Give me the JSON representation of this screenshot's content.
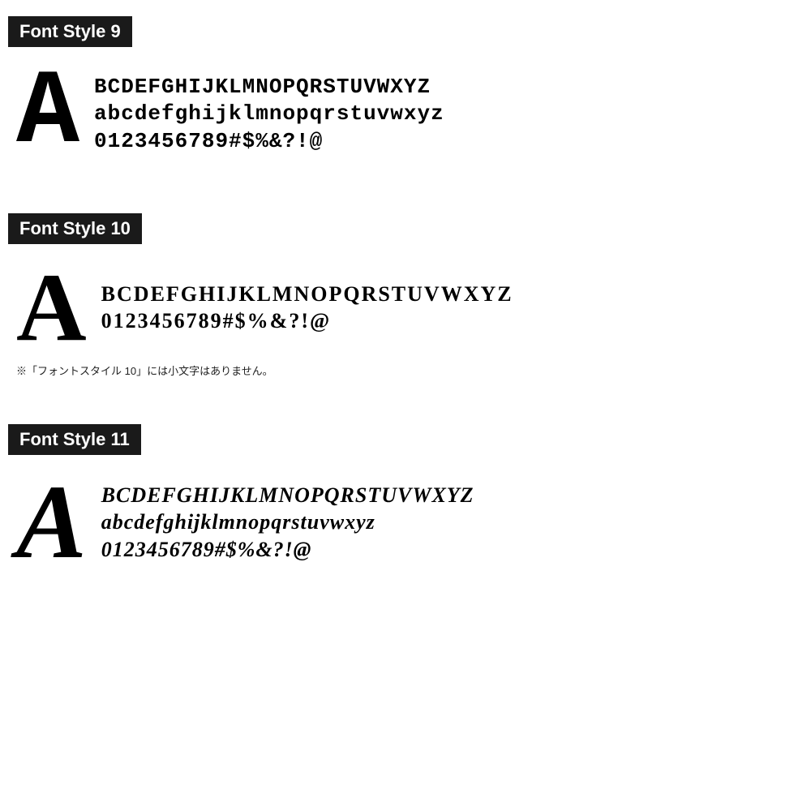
{
  "sections": [
    {
      "id": "style9",
      "label": "Font Style 9",
      "big_letter": "A",
      "lines": [
        "BCDEFGHIJKLMNOPQRSTUVWXYZ",
        "abcdefghijklmnopqrstuvwxyz",
        "0123456789#$%&?!@"
      ],
      "note": null
    },
    {
      "id": "style10",
      "label": "Font Style 10",
      "big_letter": "A",
      "lines": [
        "BCDEFGHIJKLMNOPQRSTUVWXYZ",
        "0123456789#$%&?!@"
      ],
      "note": "※「フォントスタイル 10」には小文字はありません。"
    },
    {
      "id": "style11",
      "label": "Font Style 11",
      "big_letter": "A",
      "lines": [
        "BCDEFGHIJKLMNOPQRSTUVWXYZ",
        "abcdefghijklmnopqrstuvwxyz",
        "0123456789#$%&?!@"
      ],
      "note": null
    }
  ]
}
